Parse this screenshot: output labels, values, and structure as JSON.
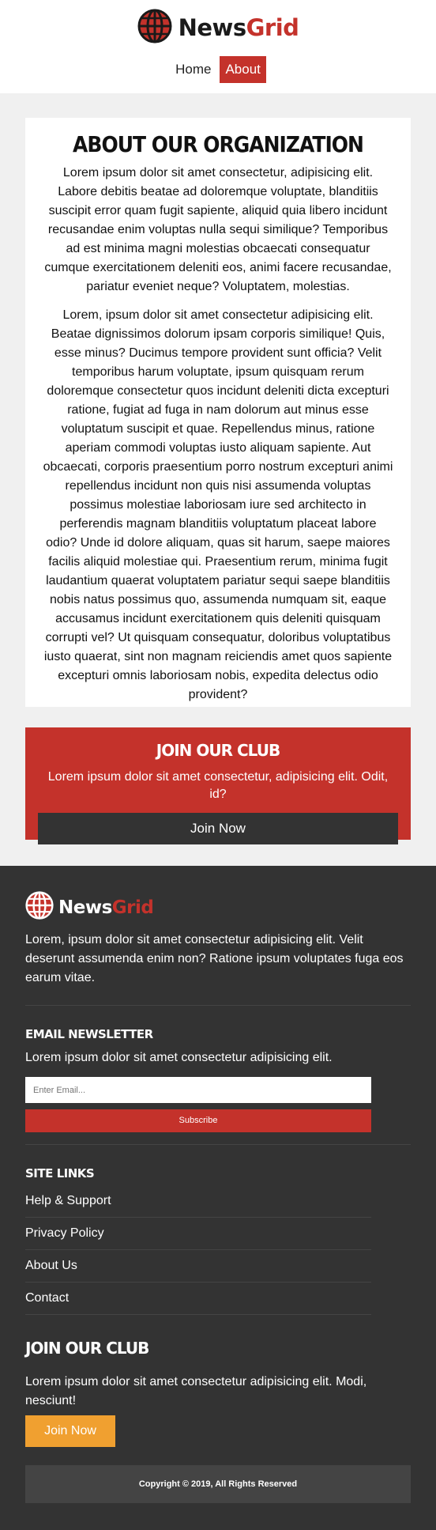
{
  "brand": {
    "part1": "News",
    "part2": "Grid",
    "accent": "#c4322b"
  },
  "nav": {
    "items": [
      {
        "label": "Home",
        "active": false
      },
      {
        "label": "About",
        "active": true
      }
    ]
  },
  "about": {
    "title": "ABOUT OUR ORGANIZATION",
    "p1": "Lorem ipsum dolor sit amet consectetur, adipisicing elit. Labore debitis beatae ad doloremque voluptate, blanditiis suscipit error quam fugit sapiente, aliquid quia libero incidunt recusandae enim voluptas nulla sequi similique? Temporibus ad est minima magni molestias obcaecati consequatur cumque exercitationem deleniti eos, animi facere recusandae, pariatur eveniet neque? Voluptatem, molestias.",
    "p2": "Lorem, ipsum dolor sit amet consectetur adipisicing elit. Beatae dignissimos dolorum ipsam corporis similique! Quis, esse minus? Ducimus tempore provident sunt officia? Velit temporibus harum voluptate, ipsum quisquam rerum doloremque consectetur quos incidunt deleniti dicta excepturi ratione, fugiat ad fuga in nam dolorum aut minus esse voluptatum suscipit et quae. Repellendus minus, ratione aperiam commodi voluptas iusto aliquam sapiente. Aut obcaecati, corporis praesentium porro nostrum excepturi animi repellendus incidunt non quis nisi assumenda voluptas possimus molestiae laboriosam iure sed architecto in perferendis magnam blanditiis voluptatum placeat labore odio? Unde id dolore aliquam, quas sit harum, saepe maiores facilis aliquid molestiae qui. Praesentium rerum, minima fugit laudantium quaerat voluptatem pariatur sequi saepe blanditiis nobis natus possimus quo, assumenda numquam sit, eaque accusamus incidunt exercitationem quis deleniti quisquam corrupti vel? Ut quisquam consequatur, doloribus voluptatibus iusto quaerat, sint non magnam reiciendis amet quos sapiente excepturi omnis laboriosam nobis, expedita delectus odio provident?"
  },
  "join_box": {
    "title": "JOIN OUR CLUB",
    "text": "Lorem ipsum dolor sit amet consectetur, adipisicing elit. Odit, id?",
    "button": "Join Now"
  },
  "footer": {
    "about": "Lorem, ipsum dolor sit amet consectetur adipisicing elit. Velit deserunt assumenda enim non? Ratione ipsum voluptates fuga eos earum vitae.",
    "newsletter": {
      "title": "EMAIL NEWSLETTER",
      "text": "Lorem ipsum dolor sit amet consectetur adipisicing elit.",
      "placeholder": "Enter Email...",
      "button": "Subscribe"
    },
    "links": {
      "title": "SITE LINKS",
      "items": [
        "Help & Support",
        "Privacy Policy",
        "About Us",
        "Contact"
      ]
    },
    "join": {
      "title": "JOIN OUR CLUB",
      "text": "Lorem ipsum dolor sit amet consectetur adipisicing elit. Modi, nesciunt!",
      "button": "Join Now",
      "button_color": "#f0a030"
    },
    "copyright": "Copyright © 2019, All Rights Reserved"
  }
}
